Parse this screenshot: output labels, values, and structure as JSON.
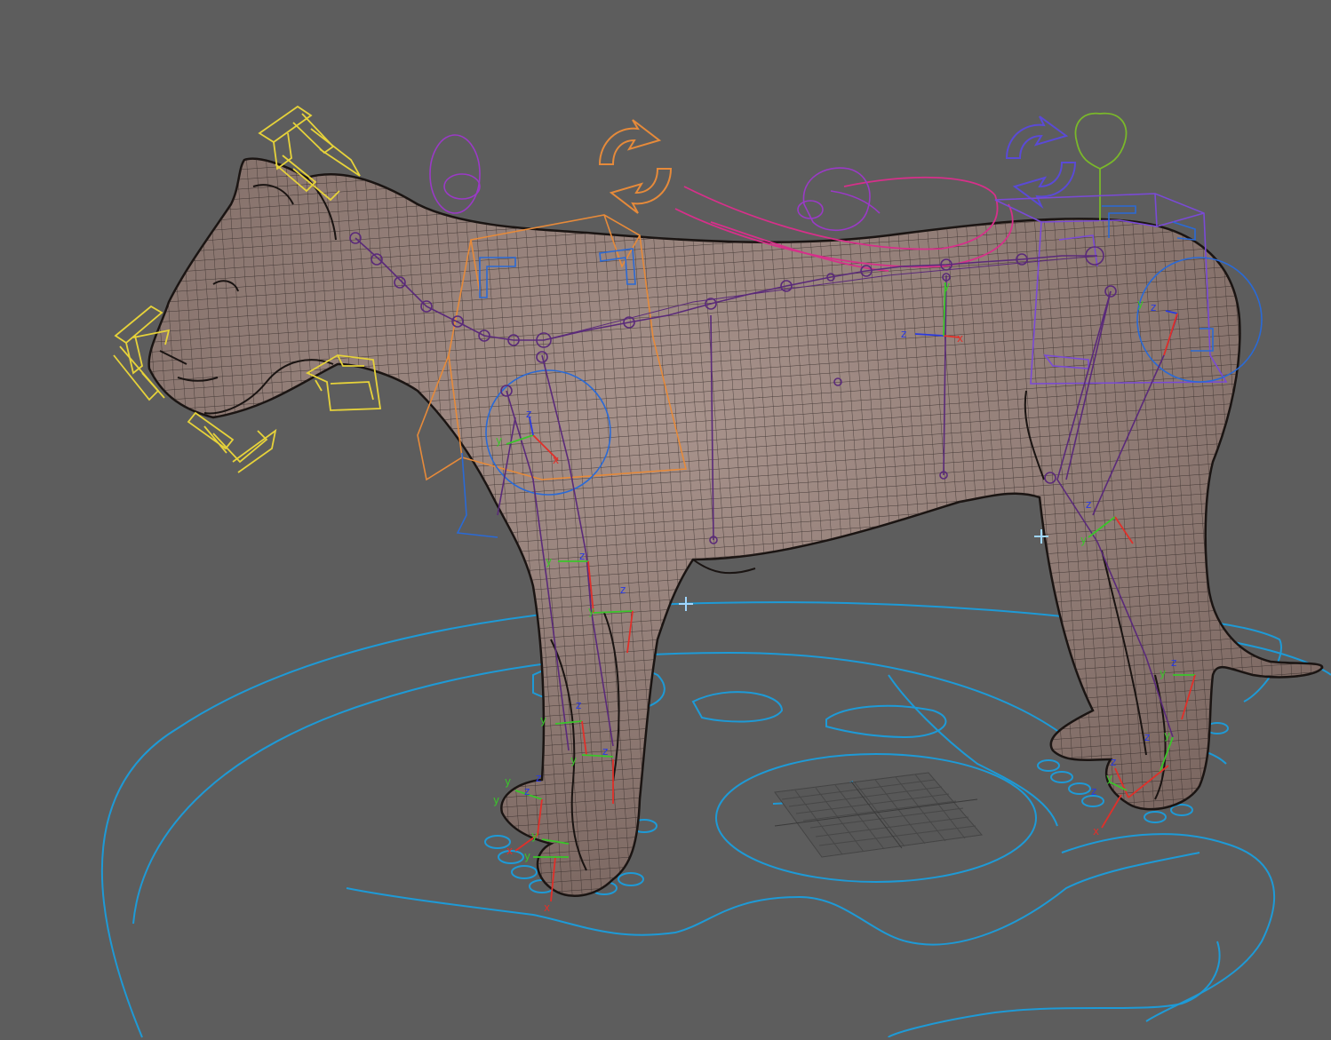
{
  "viewport": {
    "background": "#5d5d5d",
    "mesh_fill": "#8a7670",
    "mesh_wire": "#2a2220",
    "colors": {
      "ground_curves": "#1e9ad6",
      "face_controls": "#e6d23a",
      "shoulder_controls": "#e68a3a",
      "ik_rotate_icons": "#e68a3a",
      "spine_joints": "#5a2a7a",
      "hip_controls": "#7a4ad6",
      "back_curves": "#d6308a",
      "head_pivot": "#9a3ac6",
      "tail_pivot": "#7ab82a",
      "axis_x": "#e0302a",
      "axis_y": "#3ac62a",
      "axis_z": "#2a3ae0",
      "grid": "#4a4a4a"
    }
  },
  "axis_labels": {
    "x": "x",
    "y": "y",
    "z": "z"
  }
}
